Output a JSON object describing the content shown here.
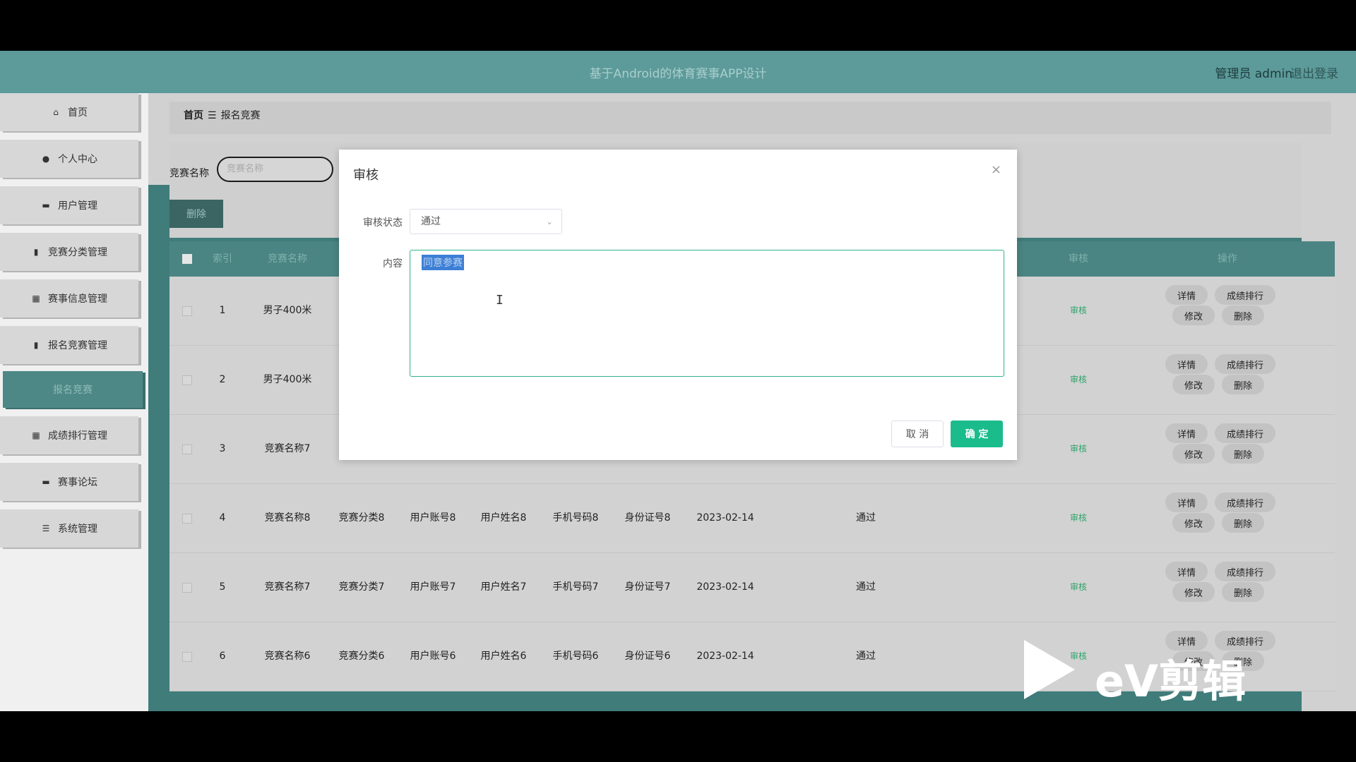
{
  "header": {
    "title": "基于Android的体育赛事APP设计",
    "user": "管理员 admin",
    "logout": "退出登录"
  },
  "sidebar": {
    "items": [
      {
        "label": "首页",
        "icon": "home-icon"
      },
      {
        "label": "个人中心",
        "icon": "user-icon"
      },
      {
        "label": "用户管理",
        "icon": "chat-icon"
      },
      {
        "label": "竞赛分类管理",
        "icon": "clipboard-icon"
      },
      {
        "label": "赛事信息管理",
        "icon": "grid-icon"
      },
      {
        "label": "报名竞赛管理",
        "icon": "clipboard-icon"
      },
      {
        "label": "成绩排行管理",
        "icon": "grid-icon"
      },
      {
        "label": "赛事论坛",
        "icon": "chat-icon"
      },
      {
        "label": "系统管理",
        "icon": "list-icon"
      }
    ],
    "active_sub": "报名竞赛"
  },
  "breadcrumb": {
    "home": "首页",
    "sep": "☰",
    "current": "报名竞赛"
  },
  "search": {
    "label": "竞赛名称",
    "placeholder": "竞赛名称"
  },
  "toolbar": {
    "delete_label": "删除"
  },
  "table": {
    "headers": [
      "索引",
      "竞赛名称",
      "审核",
      "操作"
    ],
    "rows": [
      {
        "index": "1",
        "name": "男子400米",
        "category": "",
        "account": "",
        "uname": "",
        "phone": "",
        "idcard": "",
        "date": "",
        "status": "",
        "audit": "审核"
      },
      {
        "index": "2",
        "name": "男子400米",
        "category": "",
        "account": "",
        "uname": "",
        "phone": "",
        "idcard": "",
        "date": "",
        "status": "",
        "audit": "审核"
      },
      {
        "index": "3",
        "name": "竞赛名称7",
        "category": "",
        "account": "",
        "uname": "",
        "phone": "",
        "idcard": "",
        "date": "",
        "status": "",
        "audit": "审核"
      },
      {
        "index": "4",
        "name": "竞赛名称8",
        "category": "竞赛分类8",
        "account": "用户账号8",
        "uname": "用户姓名8",
        "phone": "手机号码8",
        "idcard": "身份证号8",
        "date": "2023-02-14",
        "status": "通过",
        "audit": "审核"
      },
      {
        "index": "5",
        "name": "竞赛名称7",
        "category": "竞赛分类7",
        "account": "用户账号7",
        "uname": "用户姓名7",
        "phone": "手机号码7",
        "idcard": "身份证号7",
        "date": "2023-02-14",
        "status": "通过",
        "audit": "审核"
      },
      {
        "index": "6",
        "name": "竞赛名称6",
        "category": "竞赛分类6",
        "account": "用户账号6",
        "uname": "用户姓名6",
        "phone": "手机号码6",
        "idcard": "身份证号6",
        "date": "2023-02-14",
        "status": "通过",
        "audit": "审核"
      }
    ],
    "ops": {
      "detail": "详情",
      "rank": "成绩排行",
      "edit": "修改",
      "delete": "删除"
    }
  },
  "dialog": {
    "title": "审核",
    "close": "×",
    "status_label": "审核状态",
    "status_value": "通过",
    "content_label": "内容",
    "content_value": "同意参赛",
    "cancel": "取 消",
    "confirm": "确 定"
  },
  "watermark": {
    "text": "eV剪辑"
  },
  "colors": {
    "primary": "#1abc8c",
    "header": "#5d9a9a",
    "sidebar_active": "#4e8886"
  }
}
